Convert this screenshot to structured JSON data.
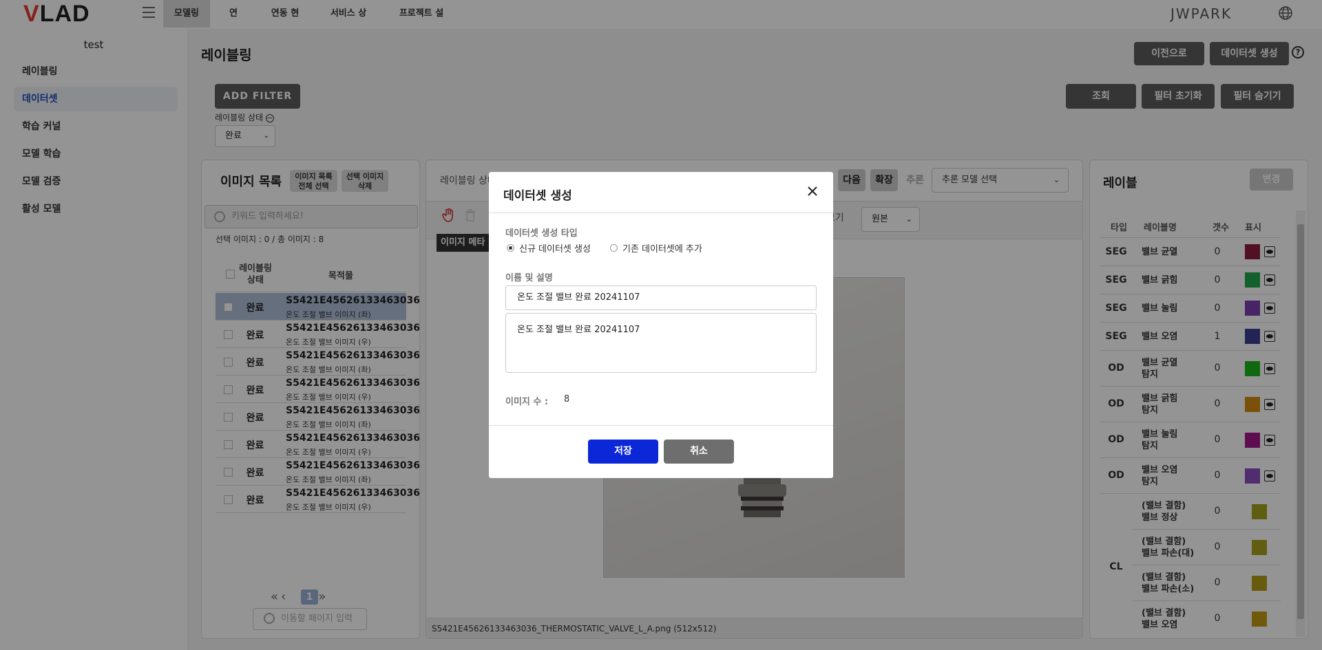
{
  "header": {
    "logo": "VLAD",
    "nav": [
      "모델링",
      "연동",
      "연동 현황",
      "서비스 상태",
      "프로젝트 설정"
    ],
    "active_nav": "모델링",
    "user": "JWPARK"
  },
  "sidebar": {
    "project": "test",
    "items": [
      "레이블링",
      "데이터셋",
      "학습 커널",
      "모델 학습",
      "모델 검증",
      "활성 모델"
    ],
    "active": "데이터셋"
  },
  "page": {
    "title": "레이블링",
    "back_button": "이전으로",
    "create_dataset_button": "데이터셋 생성",
    "help": "?"
  },
  "filter": {
    "add_filter": "ADD FILTER",
    "search": "조회",
    "reset": "필터 초기화",
    "hide": "필터 숨기기",
    "status_label": "레이블링 상태",
    "status_value": "완료"
  },
  "image_list": {
    "title": "이미지 목록",
    "select_all": [
      "이미지 목록",
      "전체 선택"
    ],
    "delete_selected": [
      "선택 이미지",
      "삭제"
    ],
    "search_placeholder": "키워드 입력하세요!",
    "count_text": "선택 이미지 : 0 / 총 이미지 : 8",
    "col_status": [
      "레이블링",
      "상태"
    ],
    "col_target": "목적물",
    "rows": [
      {
        "status": "완료",
        "name": "S5421E45626133463036",
        "sub": "온도 조절 밸브 이미지 (좌)"
      },
      {
        "status": "완료",
        "name": "S5421E45626133463036",
        "sub": "온도 조절 밸브 이미지 (우)"
      },
      {
        "status": "완료",
        "name": "S5421E45626133463036",
        "sub": "온도 조절 밸브 이미지 (좌)"
      },
      {
        "status": "완료",
        "name": "S5421E45626133463036",
        "sub": "온도 조절 밸브 이미지 (우)"
      },
      {
        "status": "완료",
        "name": "S5421E45626133463036",
        "sub": "온도 조절 밸브 이미지 (좌)"
      },
      {
        "status": "완료",
        "name": "S5421E45626133463036",
        "sub": "온도 조절 밸브 이미지 (우)"
      },
      {
        "status": "완료",
        "name": "S5421E45626133463036",
        "sub": "온도 조절 밸브 이미지 (좌)"
      },
      {
        "status": "완료",
        "name": "S5421E45626133463036",
        "sub": "온도 조절 밸브 이미지 (우)"
      }
    ],
    "current_page": "1",
    "page_input_placeholder": "이동할 페이지 입력"
  },
  "center": {
    "label": "레이블링 상태",
    "next": "다음",
    "expand": "확장",
    "infer": "추론",
    "model_placeholder": "추론 모델 선택",
    "view_label": "보기",
    "view_value": "원본",
    "meta_tag": "이미지 메타",
    "file_info": "S5421E45626133463036_THERMOSTATIC_VALVE_L_A.png (512x512)"
  },
  "labels": {
    "title": "레이블",
    "change": "변경",
    "headers": [
      "타입",
      "레이블명",
      "갯수",
      "표시"
    ],
    "rows": [
      {
        "type": "SEG",
        "name": [
          "밸브 균열"
        ],
        "count": "0",
        "color": "#8e1c41"
      },
      {
        "type": "SEG",
        "name": [
          "밸브 긁힘"
        ],
        "count": "0",
        "color": "#1fa64a"
      },
      {
        "type": "SEG",
        "name": [
          "밸브 눌림"
        ],
        "count": "0",
        "color": "#7a3fb0"
      },
      {
        "type": "SEG",
        "name": [
          "밸브 오염"
        ],
        "count": "1",
        "color": "#3b3f93"
      },
      {
        "type": "OD",
        "name": [
          "밸브 균열",
          "탐지"
        ],
        "count": "0",
        "color": "#1db41d"
      },
      {
        "type": "OD",
        "name": [
          "밸브 긁힘",
          "탐지"
        ],
        "count": "0",
        "color": "#d38a12"
      },
      {
        "type": "OD",
        "name": [
          "밸브 눌림",
          "탐지"
        ],
        "count": "0",
        "color": "#a3178c"
      },
      {
        "type": "OD",
        "name": [
          "밸브 오염",
          "탐지"
        ],
        "count": "0",
        "color": "#8a4fbf"
      }
    ],
    "cl_type": "CL",
    "cl_rows": [
      {
        "name": [
          "(밸브 결함)",
          "밸브 정상"
        ],
        "count": "0",
        "color": "#a3a31d"
      },
      {
        "name": [
          "(밸브 결함)",
          "밸브 파손(대)"
        ],
        "count": "0",
        "color": "#a8a11f"
      },
      {
        "name": [
          "(밸브 결함)",
          "밸브 파손(소)"
        ],
        "count": "0",
        "color": "#b39d18"
      },
      {
        "name": [
          "(밸브 결함)",
          "밸브 오염"
        ],
        "count": "0",
        "color": "#c39a16"
      }
    ]
  },
  "modal": {
    "title": "데이터셋 생성",
    "type_label": "데이터셋 생성 타입",
    "option_new": "신규 데이터셋 생성",
    "option_existing": "기존 데이터셋에 추가",
    "name_label": "이름 및 설명",
    "name_value": "온도 조절 밸브 완료 20241107",
    "desc_value": "온도 조절 밸브 완료 20241107",
    "image_count_label": "이미지 수 :",
    "image_count": "8",
    "save": "저장",
    "cancel": "취소"
  }
}
